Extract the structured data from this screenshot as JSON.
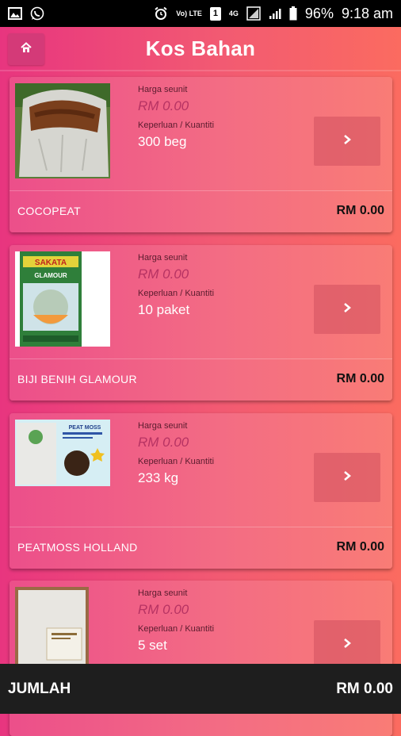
{
  "status_bar": {
    "icons_left": [
      "image-icon",
      "whatsapp-icon"
    ],
    "icons_right": [
      "alarm-icon",
      "volte-icon",
      "sim1-icon",
      "4g-icon",
      "no-sim-icon",
      "signal-icon"
    ],
    "volte_label": "Vo) LTE",
    "sim_label": "1",
    "net_label": "4G",
    "battery": "96%",
    "time": "9:18 am"
  },
  "header": {
    "title": "Kos Bahan",
    "home_icon": "home-icon"
  },
  "labels": {
    "unit_price": "Harga seunit",
    "quantity": "Keperluan / Kuantiti"
  },
  "items": [
    {
      "unit_price": "RM 0.00",
      "quantity": "300 beg",
      "name": "COCOPEAT",
      "total": "RM 0.00"
    },
    {
      "unit_price": "RM 0.00",
      "quantity": "10 paket",
      "name": "BIJI BENIH GLAMOUR",
      "total": "RM 0.00"
    },
    {
      "unit_price": "RM 0.00",
      "quantity": "233 kg",
      "name": "PEATMOSS HOLLAND",
      "total": "RM 0.00"
    },
    {
      "unit_price": "RM 0.00",
      "quantity": "5 set"
    }
  ],
  "product_images": {
    "seed_pack_brand": "SAKATA",
    "seed_pack_variety": "GLAMOUR",
    "peat_label": "PEAT MOSS"
  },
  "footer": {
    "label": "JUMLAH",
    "value": "RM 0.00"
  },
  "colors": {
    "gradient_start": "#e8357f",
    "gradient_end": "#fb6b60",
    "bottom_bar": "#1e1e1e"
  }
}
